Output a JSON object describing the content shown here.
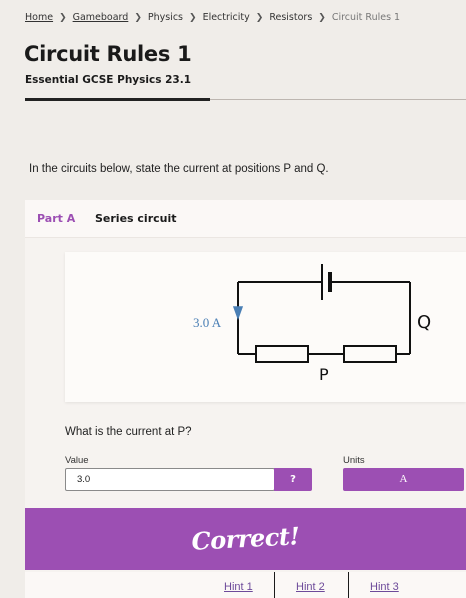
{
  "breadcrumb": [
    {
      "label": "Home",
      "link": true
    },
    {
      "label": "Gameboard",
      "link": true
    },
    {
      "label": "Physics",
      "link": false
    },
    {
      "label": "Electricity",
      "link": false
    },
    {
      "label": "Resistors",
      "link": false
    },
    {
      "label": "Circuit Rules 1",
      "link": false,
      "current": true
    }
  ],
  "breadcrumb_separator": "❯",
  "page": {
    "title": "Circuit Rules 1",
    "subtitle": "Essential GCSE Physics 23.1"
  },
  "question_intro": "In the circuits below, state the current at positions P and Q.",
  "part": {
    "label": "Part A",
    "title": "Series circuit"
  },
  "circuit": {
    "current_label": "3.0 A",
    "position_p": "P",
    "position_q": "Q"
  },
  "sub_question": "What is the current at P?",
  "answer": {
    "value_label": "Value",
    "value": "3.0",
    "help_label": "?",
    "units_label": "Units",
    "units_selected": "A"
  },
  "feedback": "Correct!",
  "hints": [
    "Hint 1",
    "Hint 2",
    "Hint 3"
  ],
  "colors": {
    "accent": "#9c4fb3",
    "background": "#f0ede9"
  }
}
